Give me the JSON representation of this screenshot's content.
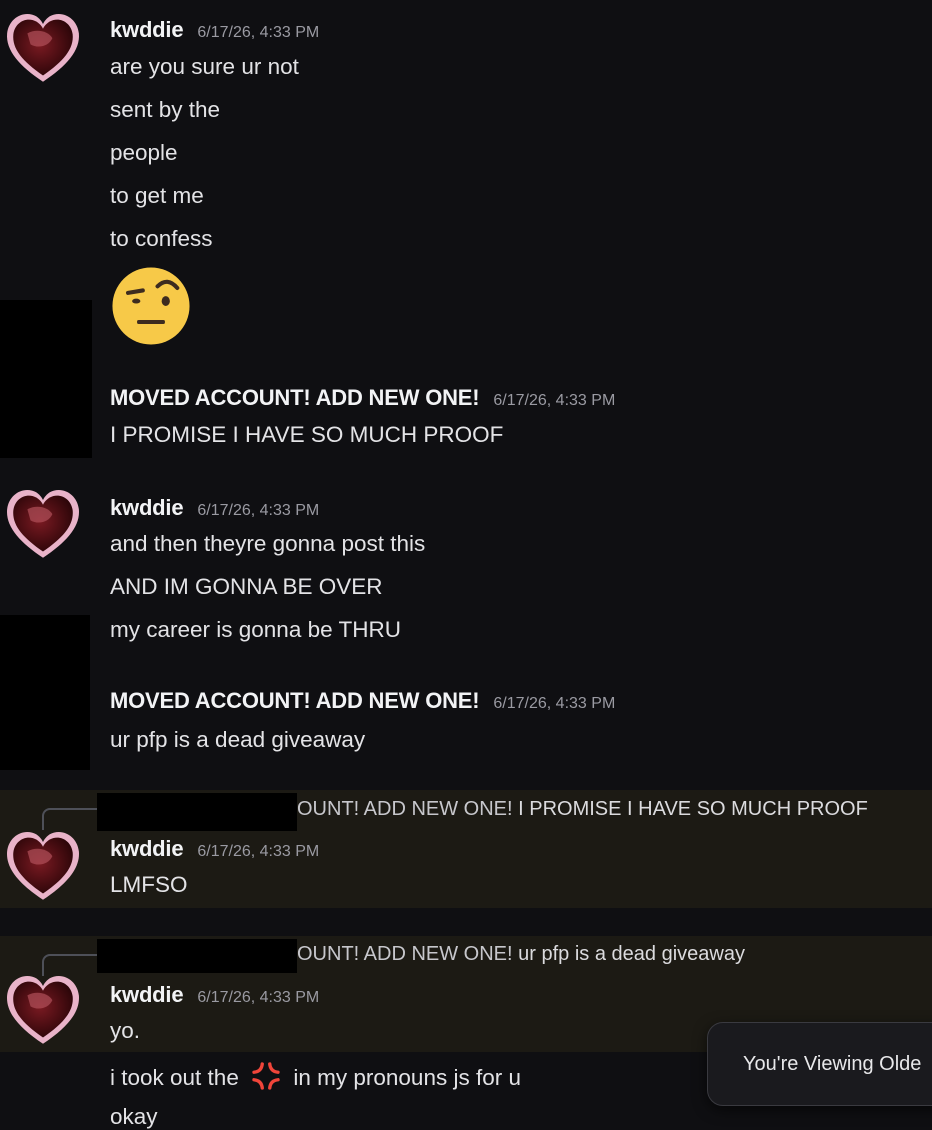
{
  "messages": [
    {
      "author": "kwddie",
      "timestamp": "6/17/26, 4:33 PM",
      "lines": [
        "are you sure ur not",
        "sent by the",
        "people",
        "to get me",
        "to confess"
      ],
      "emoji": "face-with-raised-eyebrow"
    },
    {
      "author": "MOVED ACCOUNT! ADD NEW ONE!",
      "timestamp": "6/17/26, 4:33 PM",
      "lines": [
        "I PROMISE I HAVE SO MUCH PROOF"
      ]
    },
    {
      "author": "kwddie",
      "timestamp": "6/17/26, 4:33 PM",
      "lines": [
        "and then theyre gonna post this",
        "AND IM GONNA BE OVER",
        "my career is gonna be THRU"
      ]
    },
    {
      "author": "MOVED ACCOUNT! ADD NEW ONE!",
      "timestamp": "6/17/26, 4:33 PM",
      "lines": [
        "ur pfp is a dead giveaway"
      ]
    },
    {
      "reply": {
        "author_fragment": "OUNT! ADD NEW ONE!",
        "text": "I PROMISE I HAVE SO MUCH PROOF"
      },
      "author": "kwddie",
      "timestamp": "6/17/26, 4:33 PM",
      "lines": [
        "LMFSO"
      ]
    },
    {
      "reply": {
        "author_fragment": "OUNT! ADD NEW ONE!",
        "text": "ur pfp is a dead giveaway"
      },
      "author": "kwddie",
      "timestamp": "6/17/26, 4:33 PM",
      "lines": [
        "yo.",
        "i took out the",
        "in my pronouns js for u",
        "okay"
      ],
      "inline_emoji": "anger-symbol"
    }
  ],
  "toast": {
    "label": "You're Viewing Olde"
  },
  "colors": {
    "background": "#0f0f12",
    "highlight": "#1c1a14",
    "anger": "#f0453a"
  }
}
